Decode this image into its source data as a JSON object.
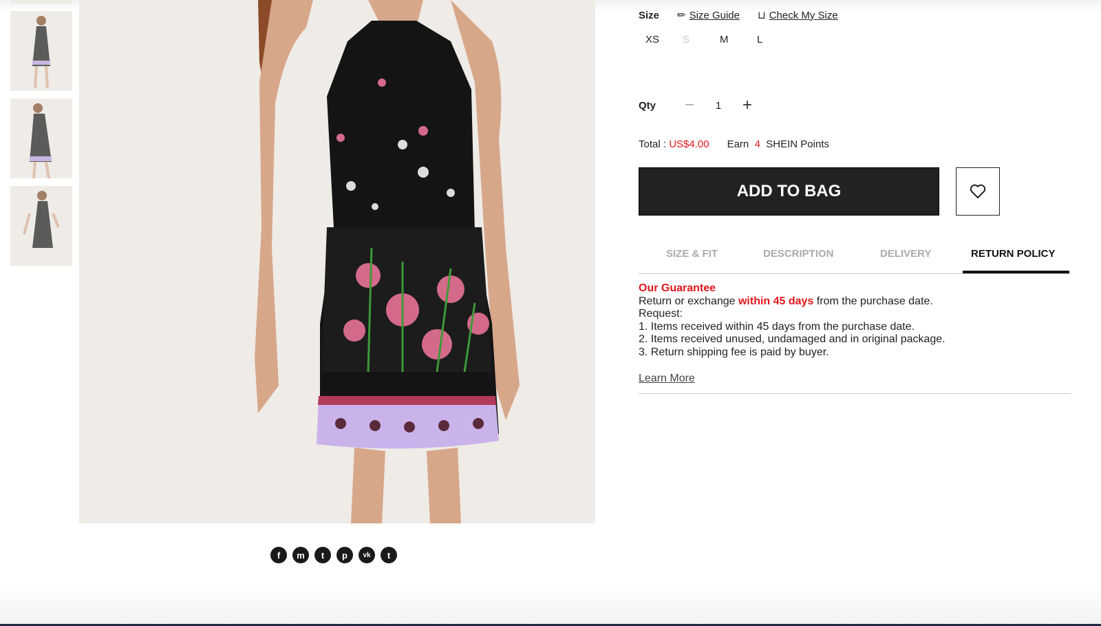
{
  "size": {
    "label": "Size",
    "size_guide": "Size Guide",
    "check_my_size": "Check My Size",
    "options": [
      {
        "label": "XS",
        "available": true
      },
      {
        "label": "S",
        "available": false
      },
      {
        "label": "M",
        "available": true
      },
      {
        "label": "L",
        "available": true
      }
    ]
  },
  "qty": {
    "label": "Qty",
    "minus": "−",
    "value": "1",
    "plus": "+"
  },
  "total": {
    "label": "Total :",
    "price": "US$4.00",
    "earn_prefix": "Earn",
    "points": "4",
    "earn_suffix": "SHEIN Points"
  },
  "actions": {
    "add_to_bag": "ADD TO BAG",
    "wishlist_icon": "heart-outline-icon"
  },
  "tabs": [
    {
      "label": "SIZE & FIT",
      "active": false
    },
    {
      "label": "DESCRIPTION",
      "active": false
    },
    {
      "label": "DELIVERY",
      "active": false
    },
    {
      "label": "RETURN POLICY",
      "active": true
    }
  ],
  "return_policy": {
    "heading": "Our Guarantee",
    "line1_pre": "Return or exchange ",
    "line1_highlight": "within 45 days",
    "line1_post": " from the purchase date.",
    "request": "Request:",
    "items": [
      "1. Items received within 45 days from the purchase date.",
      "2. Items received unused, undamaged and in original package.",
      "3. Return shipping fee is paid by buyer."
    ],
    "learn_more": "Learn More"
  },
  "share": [
    {
      "icon": "facebook-icon",
      "glyph": "f"
    },
    {
      "icon": "messenger-icon",
      "glyph": "m"
    },
    {
      "icon": "twitter-icon",
      "glyph": "t"
    },
    {
      "icon": "pinterest-icon",
      "glyph": "p"
    },
    {
      "icon": "vk-icon",
      "glyph": "vk"
    },
    {
      "icon": "tumblr-icon",
      "glyph": "t"
    }
  ],
  "colors": {
    "accent_red": "#e0161a",
    "button_dark": "#222222"
  }
}
